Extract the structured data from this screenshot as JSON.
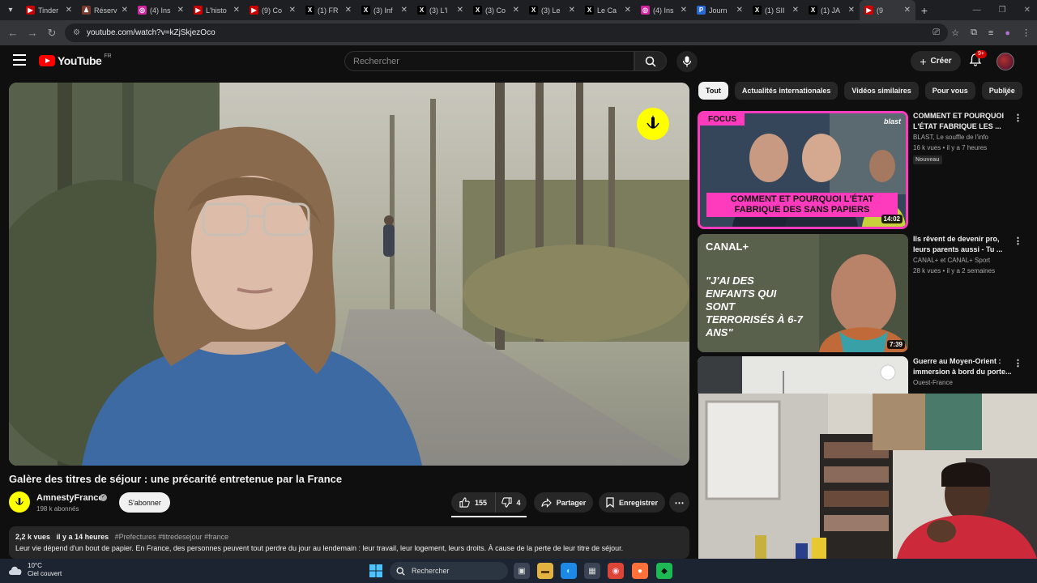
{
  "browser": {
    "tabs": [
      {
        "title": "Tinder",
        "fav_color": "#cc0000",
        "fav_glyph": "▶"
      },
      {
        "title": "Réserv",
        "fav_color": "#7a3b2e",
        "fav_glyph": "♟"
      },
      {
        "title": "(4) Ins",
        "fav_color": "#d6249f",
        "fav_glyph": "◎"
      },
      {
        "title": "L'histo",
        "fav_color": "#cc0000",
        "fav_glyph": "▶"
      },
      {
        "title": "(9) Co",
        "fav_color": "#cc0000",
        "fav_glyph": "▶"
      },
      {
        "title": "(1) FR",
        "fav_color": "#000000",
        "fav_glyph": "X"
      },
      {
        "title": "(3) Inf",
        "fav_color": "#000000",
        "fav_glyph": "X"
      },
      {
        "title": "(3) L'l",
        "fav_color": "#000000",
        "fav_glyph": "X"
      },
      {
        "title": "(3) Co",
        "fav_color": "#000000",
        "fav_glyph": "X"
      },
      {
        "title": "(3) Le",
        "fav_color": "#000000",
        "fav_glyph": "X"
      },
      {
        "title": "Le Ca",
        "fav_color": "#000000",
        "fav_glyph": "X"
      },
      {
        "title": "(4) Ins",
        "fav_color": "#d6249f",
        "fav_glyph": "◎"
      },
      {
        "title": "Journ",
        "fav_color": "#2a6ad8",
        "fav_glyph": "P"
      },
      {
        "title": "(1) SII",
        "fav_color": "#000000",
        "fav_glyph": "X"
      },
      {
        "title": "(1) JA",
        "fav_color": "#000000",
        "fav_glyph": "X"
      },
      {
        "title": "(9",
        "fav_color": "#cc0000",
        "fav_glyph": "▶"
      }
    ],
    "url": "youtube.com/watch?v=kZjSkjezOco"
  },
  "youtube": {
    "logo_text": "YouTube",
    "country": "FR",
    "search_placeholder": "Rechercher",
    "create_label": "Créer",
    "notif_count": "9+"
  },
  "video": {
    "title": "Galère des titres de séjour : une précarité entretenue par la France",
    "channel": "AmnestyFrance",
    "subscribers": "198 k abonnés",
    "subscribe_label": "S'abonner",
    "likes": "155",
    "dislikes": "4",
    "share_label": "Partager",
    "save_label": "Enregistrer",
    "views": "2,2 k vues",
    "age": "il y a 14 heures",
    "hashtags": "#Prefectures #titredesejour #france",
    "description": "Leur vie dépend d'un bout de papier. En France, des personnes peuvent tout perdre du jour au lendemain : leur travail, leur logement, leurs droits. À cause de la perte de leur titre de séjour."
  },
  "chips": [
    "Tout",
    "Actualités internationales",
    "Vidéos similaires",
    "Pour vous",
    "Publiée"
  ],
  "related": [
    {
      "title": "COMMENT ET POURQUOI L'ÉTAT FABRIQUE LES ...",
      "channel": "BLAST, Le souffle de l'info",
      "meta": "16 k vues • il y a 7 heures",
      "badge": "Nouveau",
      "duration": "14:02",
      "thumb_tag": "FOCUS",
      "thumb_brand": "blast",
      "thumb_caption": "COMMENT ET POURQUOI L'ÉTAT FABRIQUE DES SANS PAPIERS"
    },
    {
      "title": "Ils rêvent de devenir pro, leurs parents aussi - Tu ...",
      "channel": "CANAL+ et CANAL+ Sport",
      "meta": "28 k vues • il y a 2 semaines",
      "duration": "7:39",
      "thumb_tag": "CANAL+",
      "thumb_caption": "\"J'AI DES ENFANTS QUI SONT TERRORISÉS À 6-7 ANS\""
    },
    {
      "title": "Guerre au Moyen-Orient : immersion à bord du porte...",
      "channel": "Ouest-France"
    }
  ],
  "taskbar": {
    "temperature": "10°C",
    "weather": "Ciel couvert",
    "search_label": "Rechercher"
  }
}
